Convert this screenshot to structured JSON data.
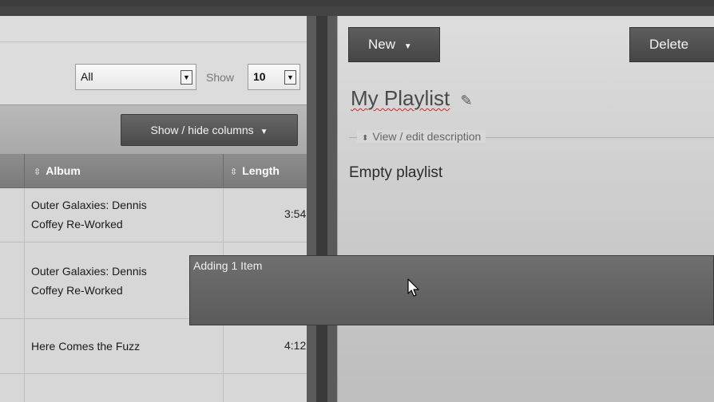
{
  "filter": {
    "selected": "All"
  },
  "show": {
    "label": "Show",
    "selected": "10"
  },
  "toolbar": {
    "show_hide_columns": "Show / hide columns"
  },
  "table": {
    "columns": [
      "Album",
      "Length"
    ],
    "rows": [
      {
        "album_line1": "Outer Galaxies: Dennis",
        "album_line2": "Coffey Re-Worked",
        "length": "3:54"
      },
      {
        "album_line1": "Outer Galaxies: Dennis",
        "album_line2": "Coffey Re-Worked",
        "length": ""
      },
      {
        "album_line1": "Here Comes the Fuzz",
        "album_line2": "",
        "length": "4:12"
      }
    ]
  },
  "playlist": {
    "new_label": "New",
    "delete_label": "Delete",
    "title": "My Playlist",
    "view_edit_description": "View / edit description",
    "empty_text": "Empty playlist"
  },
  "drag": {
    "label": "Adding 1 Item"
  },
  "icons": {
    "sort": "sort-both-icon",
    "caret": "caret-down-icon",
    "pencil": "pencil-icon",
    "cursor": "mouse-pointer-icon"
  }
}
